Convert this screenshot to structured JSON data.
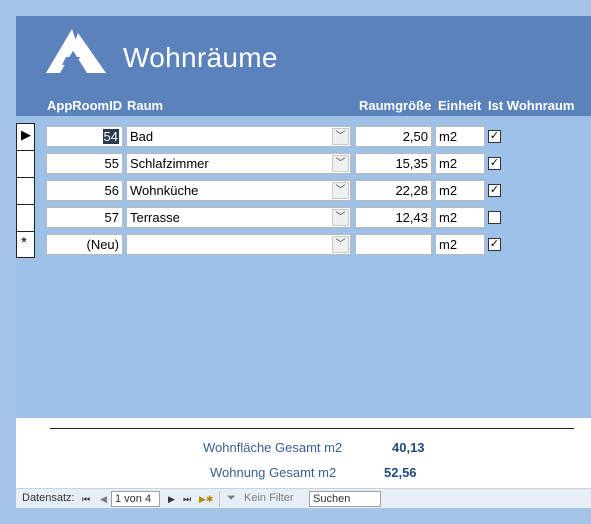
{
  "form": {
    "title": "Wohnräume",
    "logo_icon": "logo-triangle-icon"
  },
  "columns": {
    "id": "AppRoomID",
    "raum": "Raum",
    "size": "Raumgröße",
    "unit": "Einheit",
    "wohnraum": "Ist Wohnraum"
  },
  "rows": [
    {
      "id": "54",
      "raum": "Bad",
      "size": "2,50",
      "unit": "m2",
      "wohnraum": true
    },
    {
      "id": "55",
      "raum": "Schlafzimmer",
      "size": "15,35",
      "unit": "m2",
      "wohnraum": true
    },
    {
      "id": "56",
      "raum": "Wohnküche",
      "size": "22,28",
      "unit": "m2",
      "wohnraum": true
    },
    {
      "id": "57",
      "raum": "Terrasse",
      "size": "12,43",
      "unit": "m2",
      "wohnraum": false
    }
  ],
  "new_row": {
    "id": "(Neu)",
    "raum": "",
    "size": "",
    "unit": "m2",
    "wohnraum": true,
    "marker": "*"
  },
  "current_marker": "▶",
  "checkmark": "✓",
  "totals": {
    "wohnflaeche_label": "Wohnfläche Gesamt m2",
    "wohnflaeche_value": "40,13",
    "wohnung_label": "Wohnung Gesamt m2",
    "wohnung_value": "52,56"
  },
  "navigation": {
    "label": "Datensatz:",
    "position": "1 von 4",
    "filter": "Kein Filter",
    "search": "Suchen",
    "first": "⏮",
    "prev": "◀",
    "next": "▶",
    "last": "⏭",
    "new": "▶✱"
  },
  "colors": {
    "header": "#5b82bb",
    "body": "#9ec1e7",
    "accent_text": "#3a5f96"
  }
}
